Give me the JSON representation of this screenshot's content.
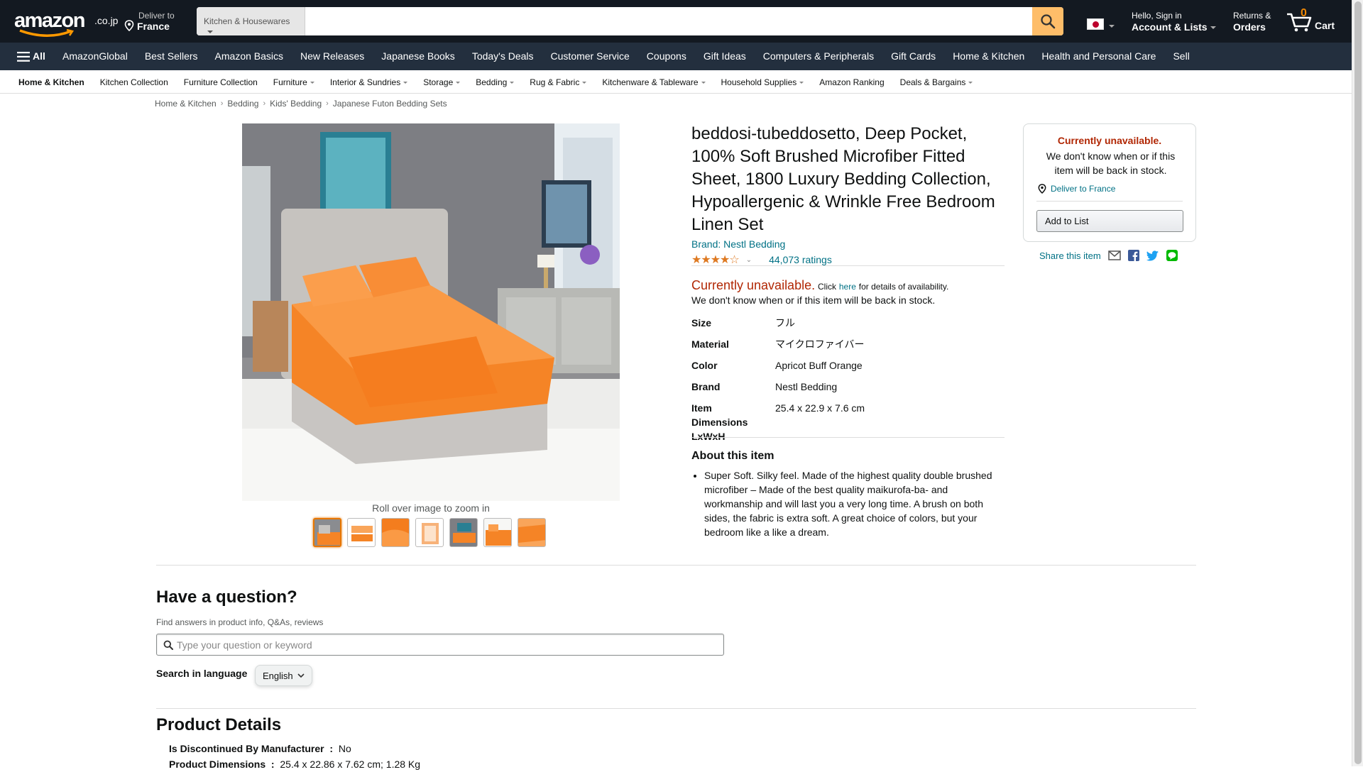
{
  "header": {
    "logo_word": "amazon",
    "logo_tld": ".co.jp",
    "deliver_line1": "Deliver to",
    "deliver_line2": "France",
    "search_dept": "Kitchen & Housewares",
    "search_value": "",
    "account_line1": "Hello, Sign in",
    "account_line2": "Account & Lists",
    "returns_line1": "Returns &",
    "returns_line2": "Orders",
    "cart_count": "0",
    "cart_label": "Cart",
    "accent": "#febd69",
    "bg": "#131921"
  },
  "nav": {
    "all_label": "All",
    "items": [
      "AmazonGlobal",
      "Best Sellers",
      "Amazon Basics",
      "New Releases",
      "Japanese Books",
      "Today's Deals",
      "Customer Service",
      "Coupons",
      "Gift Ideas",
      "Computers & Peripherals",
      "Gift Cards",
      "Home & Kitchen",
      "Health and Personal Care",
      "Sell"
    ]
  },
  "subnav": {
    "items": [
      "Home & Kitchen",
      "Kitchen Collection",
      "Furniture Collection",
      "Furniture",
      "Interior & Sundries",
      "Storage",
      "Bedding",
      "Rug & Fabric",
      "Kitchenware & Tableware",
      "Household Supplies",
      "Amazon Ranking",
      "Deals & Bargains"
    ]
  },
  "breadcrumb": [
    "Home & Kitchen",
    "Bedding",
    "Kids' Bedding",
    "Japanese Futon Bedding Sets"
  ],
  "product": {
    "zoom_hint": "Roll over image to zoom in",
    "title": "beddosi-tubeddosetto, Deep Pocket, 100% Soft Brushed Microfiber Fitted Sheet, 1800 Luxury Bedding Collection, Hypoallergenic & Wrinkle Free Bedroom Linen Set",
    "brand_link": "Brand: Nestl Bedding",
    "stars": "★★★★☆",
    "rating_value": 4.5,
    "ratings_count": "44,073 ratings",
    "unavailable": "Currently unavailable.",
    "click_text": "Click",
    "here_link": "here",
    "details_text": "for details of availability.",
    "back_in_stock": "We don't know when or if this item will be back in stock.",
    "specs": [
      {
        "k": "Size",
        "v": "フル"
      },
      {
        "k": "Material",
        "v": "マイクロファイバー"
      },
      {
        "k": "Color",
        "v": "Apricot Buff Orange"
      },
      {
        "k": "Brand",
        "v": "Nestl Bedding"
      },
      {
        "k": "Item Dimensions LxWxH",
        "v": "25.4 x 22.9 x 7.6 cm"
      }
    ],
    "about_heading": "About this item",
    "about_items": [
      "Super Soft. Silky feel. Made of the highest quality double brushed microfiber – Made of the best quality maikurofa-ba- and workmanship and will last you a very long time. A brush on both sides, the fabric is extra soft. A great choice of colors, but your bedroom like a like a dream."
    ]
  },
  "buybox": {
    "status": "Currently unavailable.",
    "message": "We don't know when or if this item will be back in stock.",
    "deliver": "Deliver to France",
    "add_to_list": "Add to List",
    "share_label": "Share this item"
  },
  "question": {
    "heading": "Have a question?",
    "sub": "Find answers in product info, Q&As, reviews",
    "placeholder": "Type your question or keyword",
    "lang_label": "Search in language",
    "lang_value": "English"
  },
  "details": {
    "heading": "Product Details",
    "rows": [
      {
        "k": "Is Discontinued By Manufacturer ‏ : ‎",
        "v": "No"
      },
      {
        "k": "Product Dimensions ‏ : ‎",
        "v": "25.4 x 22.86 x 7.62 cm; 1.28 Kg"
      }
    ]
  }
}
